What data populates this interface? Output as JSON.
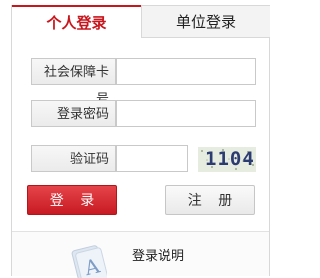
{
  "tabs": {
    "personal": "个人登录",
    "unit": "单位登录"
  },
  "form": {
    "ssn_label": "社会保障卡号",
    "ssn_value": "",
    "password_label": "登录密码",
    "password_value": "",
    "captcha_label": "验证码",
    "captcha_value": "",
    "captcha_code": "1104"
  },
  "buttons": {
    "login": "登 录",
    "register": "注 册"
  },
  "help": {
    "label": "登录说明",
    "icon": "document-icon"
  },
  "colors": {
    "accent": "#c8161d",
    "login_button": "#d62d33",
    "captcha_text": "#2c3c70"
  }
}
